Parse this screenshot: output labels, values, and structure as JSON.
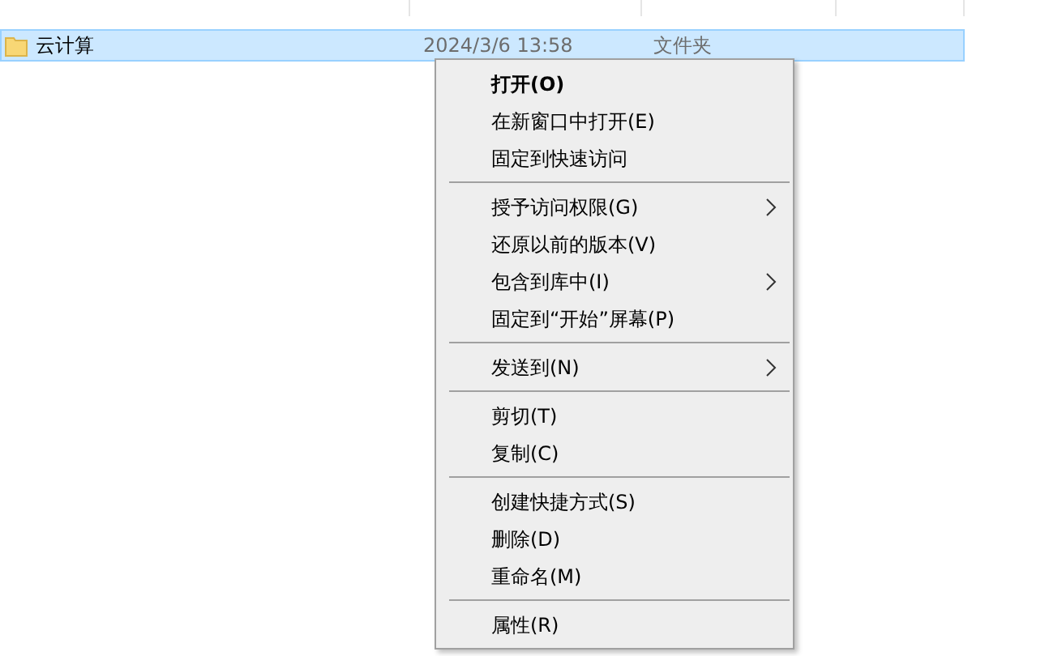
{
  "rows": [
    {
      "name": "云计算",
      "date": "2024/3/6 13:58",
      "type": "文件夹",
      "selected": true
    }
  ],
  "context_menu": {
    "items": [
      {
        "kind": "item",
        "label": "打开(O)",
        "bold": true,
        "submenu": false
      },
      {
        "kind": "item",
        "label": "在新窗口中打开(E)",
        "bold": false,
        "submenu": false
      },
      {
        "kind": "item",
        "label": "固定到快速访问",
        "bold": false,
        "submenu": false
      },
      {
        "kind": "separator"
      },
      {
        "kind": "item",
        "label": "授予访问权限(G)",
        "bold": false,
        "submenu": true
      },
      {
        "kind": "item",
        "label": "还原以前的版本(V)",
        "bold": false,
        "submenu": false
      },
      {
        "kind": "item",
        "label": "包含到库中(I)",
        "bold": false,
        "submenu": true
      },
      {
        "kind": "item",
        "label": "固定到“开始”屏幕(P)",
        "bold": false,
        "submenu": false
      },
      {
        "kind": "separator"
      },
      {
        "kind": "item",
        "label": "发送到(N)",
        "bold": false,
        "submenu": true
      },
      {
        "kind": "separator"
      },
      {
        "kind": "item",
        "label": "剪切(T)",
        "bold": false,
        "submenu": false
      },
      {
        "kind": "item",
        "label": "复制(C)",
        "bold": false,
        "submenu": false
      },
      {
        "kind": "separator"
      },
      {
        "kind": "item",
        "label": "创建快捷方式(S)",
        "bold": false,
        "submenu": false
      },
      {
        "kind": "item",
        "label": "删除(D)",
        "bold": false,
        "submenu": false
      },
      {
        "kind": "item",
        "label": "重命名(M)",
        "bold": false,
        "submenu": false
      },
      {
        "kind": "separator"
      },
      {
        "kind": "item",
        "label": "属性(R)",
        "bold": false,
        "submenu": false
      }
    ]
  }
}
